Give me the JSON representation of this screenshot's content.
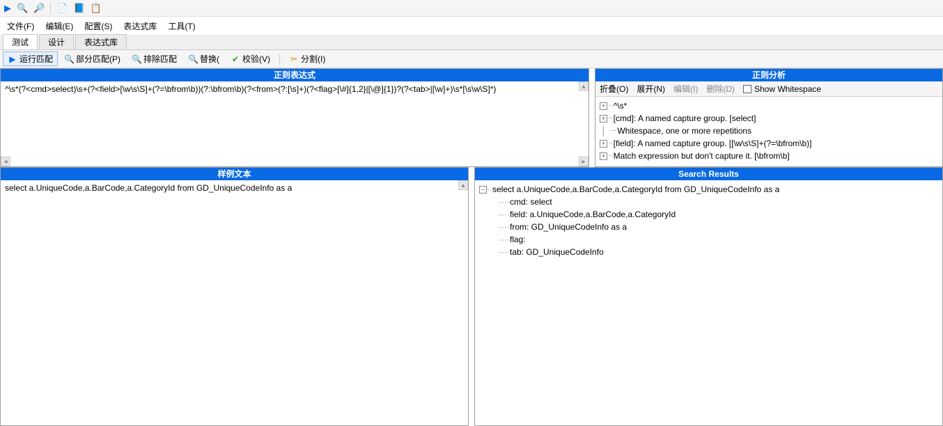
{
  "top_icons": [
    "▶",
    "🔍",
    "🔎",
    "📄",
    "📘",
    "📋"
  ],
  "menu": {
    "file": "文件(F)",
    "edit": "编辑(E)",
    "config": "配置(S)",
    "library": "表达式库",
    "tools": "工具(T)"
  },
  "tabs": {
    "test": "测试",
    "design": "设计",
    "library": "表达式库"
  },
  "actions": {
    "run": "运行匹配",
    "partial": "部分匹配(P)",
    "exclude": "排除匹配",
    "replace": "替换(",
    "verify": "校验(V)",
    "split": "分割(I)"
  },
  "regex_panel": {
    "title": "正则表达式",
    "pattern_before": "^\\s*(?<cmd>select)\\s+(?<field>[\\w\\s\\S]+(?=\\bfrom\\b))(?:\\bfrom\\b)(?<from>(?:[\\s]+)(?<flag>[\\#]{1,2}|[\\@]{1})?(?<tab>",
    "pattern_after": "[\\w]+)\\s*[\\s\\w\\S]*)"
  },
  "analysis_panel": {
    "title": "正则分析",
    "fold": "折叠(O)",
    "expand": "展开(N)",
    "edit_btn": "编辑(I)",
    "delete_btn": "删除(D)",
    "show_ws": "Show Whitespace",
    "nodes": [
      "^\\s*",
      "[cmd]: A named capture group. [select]",
      "Whitespace, one or more repetitions",
      "[field]: A named capture group. [[\\w\\s\\S]+(?=\\bfrom\\b)]",
      "Match expression but don't capture it. [\\bfrom\\b]"
    ]
  },
  "sample_panel": {
    "title": "样例文本",
    "text": "select  a.UniqueCode,a.BarCode,a.CategoryId from GD_UniqueCodeInfo as a"
  },
  "results_panel": {
    "title": "Search Results",
    "root": "select  a.UniqueCode,a.BarCode,a.CategoryId from GD_UniqueCodeInfo as a",
    "children": [
      "cmd: select",
      "field: a.UniqueCode,a.BarCode,a.CategoryId",
      "from:  GD_UniqueCodeInfo as a",
      "flag:",
      "tab: GD_UniqueCodeInfo"
    ]
  }
}
